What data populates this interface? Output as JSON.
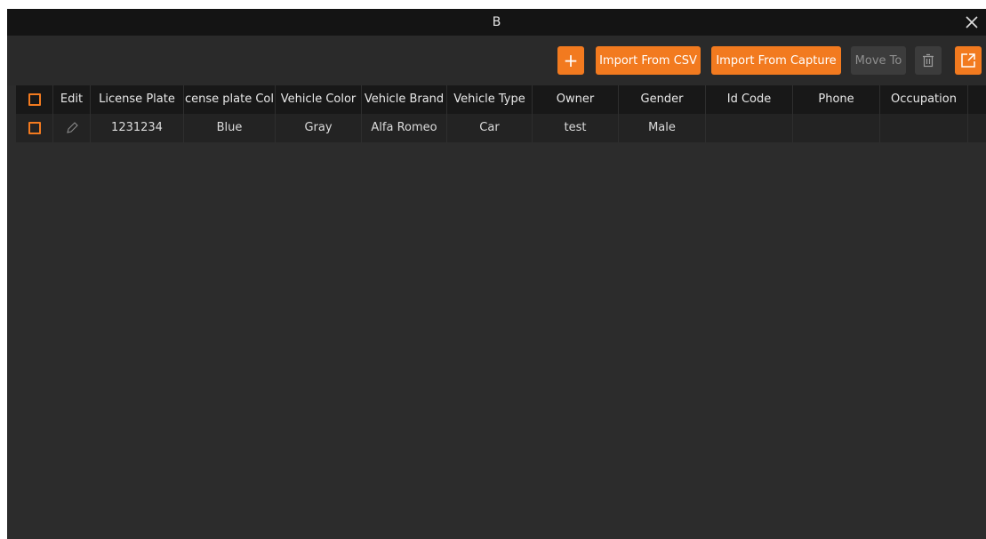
{
  "window": {
    "title": "B"
  },
  "icons": {
    "close": "close-icon",
    "add": "plus-icon",
    "delete": "trash-icon",
    "export": "export-icon",
    "edit": "pencil-icon"
  },
  "colors": {
    "accent": "#f27a1f",
    "titlebar": "#141414",
    "background": "#2c2c2c"
  },
  "toolbar": {
    "add_label": "+",
    "import_csv_label": "Import From CSV",
    "import_capture_label": "Import From Capture",
    "move_to_label": "Move To"
  },
  "table": {
    "columns": [
      "Edit",
      "License Plate",
      "cense plate Col",
      "Vehicle Color",
      "Vehicle Brand",
      "Vehicle Type",
      "Owner",
      "Gender",
      "Id Code",
      "Phone",
      "Occupation"
    ],
    "rows": [
      {
        "license_plate": "1231234",
        "plate_color": "Blue",
        "vehicle_color": "Gray",
        "vehicle_brand": "Alfa Romeo",
        "vehicle_type": "Car",
        "owner": "test",
        "gender": "Male",
        "id_code": "",
        "phone": "",
        "occupation": ""
      }
    ]
  }
}
